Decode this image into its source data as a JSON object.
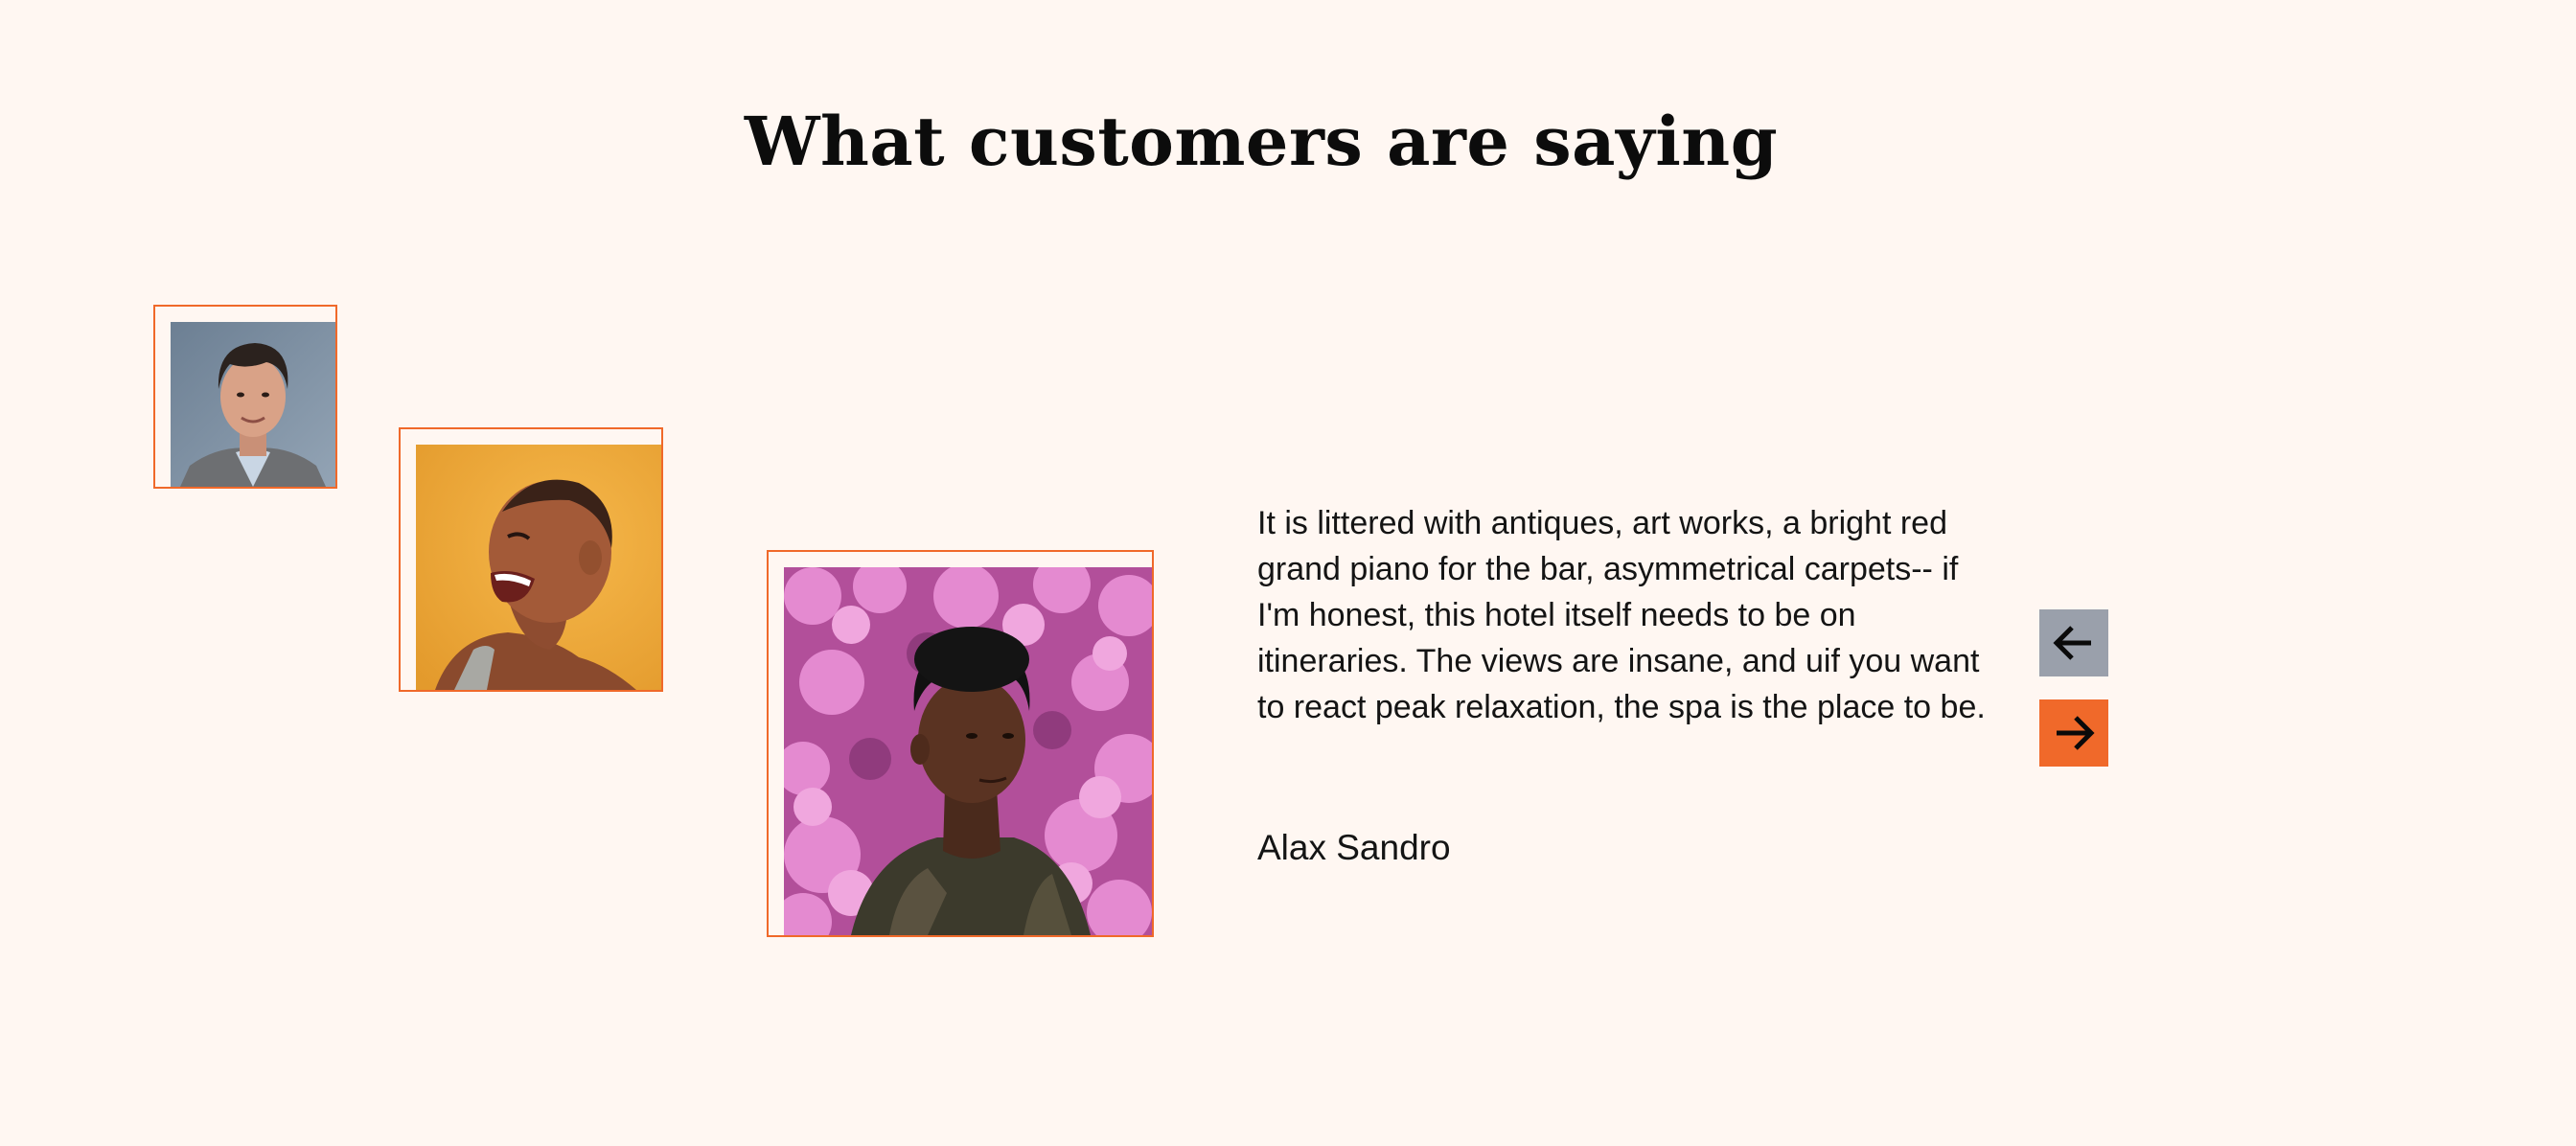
{
  "section": {
    "heading": "What customers are saying"
  },
  "testimonials": [
    {
      "avatar_icon": "man-portrait-gray-background",
      "active": false
    },
    {
      "avatar_icon": "woman-laughing-yellow-background",
      "active": false
    },
    {
      "avatar_icon": "man-portrait-pink-flowers",
      "active": true
    }
  ],
  "active_testimonial": {
    "quote": "It is littered with antiques, art works, a bright red grand piano for the bar, asymmetrical carpets-- if I'm honest, this hotel itself needs to be on itineraries. The views are insane, and uif you want to react peak relaxation, the spa is the place to be.",
    "author": "Alax Sandro"
  },
  "navigation": {
    "prev_icon": "arrow-left-icon",
    "next_icon": "arrow-right-icon"
  },
  "colors": {
    "background": "#fff7f2",
    "accent": "#f0692a",
    "prev_button": "#9aa0ab",
    "next_button": "#f0692a",
    "text": "#111111"
  }
}
